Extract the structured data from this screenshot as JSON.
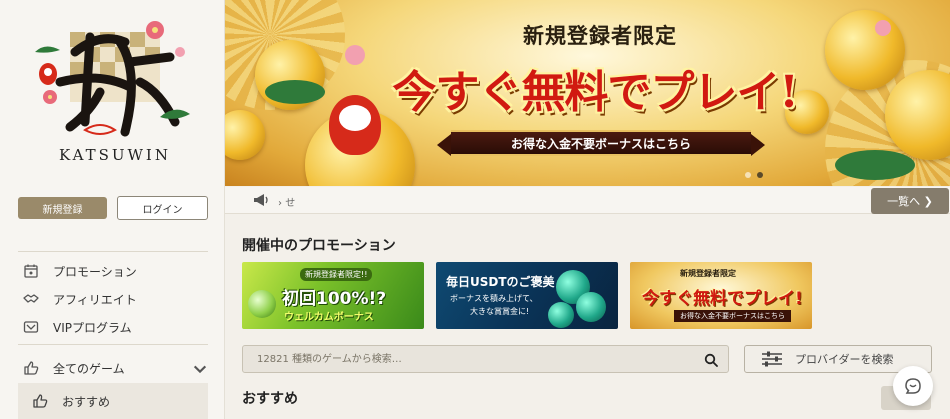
{
  "logo": {
    "text": "KATSUWIN"
  },
  "auth": {
    "register": "新規登録",
    "login": "ログイン"
  },
  "nav": {
    "items": [
      {
        "label": "プロモーション",
        "icon": "calendar-icon"
      },
      {
        "label": "アフィリエイト",
        "icon": "handshake-icon"
      },
      {
        "label": "VIPプログラム",
        "icon": "vip-icon"
      }
    ],
    "all_games": "全てのゲーム",
    "recommended": "おすすめ"
  },
  "banner": {
    "sub": "新規登録者限定",
    "main": "今すぐ無料でプレイ!",
    "ribbon": "お得な入金不要ボーナスはこちら"
  },
  "notice": {
    "text": "せ",
    "more_button": "一覧へ ❯"
  },
  "promotions": {
    "title": "開催中のプロモーション",
    "cards": [
      {
        "top": "新規登録者限定!!",
        "main": "初回100%!?",
        "sub": "ウェルカムボーナス"
      },
      {
        "main": "毎日USDTのご褒美",
        "sub1": "ボーナスを積み上げて、",
        "sub2": "大きな賞賞金に!"
      },
      {
        "top": "新規登録者限定",
        "main": "今すぐ無料でプレイ!",
        "sub": "お得な入金不要ボーナスはこちら"
      }
    ]
  },
  "search": {
    "placeholder": "12821 種類のゲームから検索…"
  },
  "provider": {
    "label": "プロバイダーを検索"
  },
  "recommended_title": "おすすめ",
  "colors": {
    "accent": "#9a8a6a",
    "button_dark": "#857c6c",
    "banner_red": "#d11a10"
  }
}
